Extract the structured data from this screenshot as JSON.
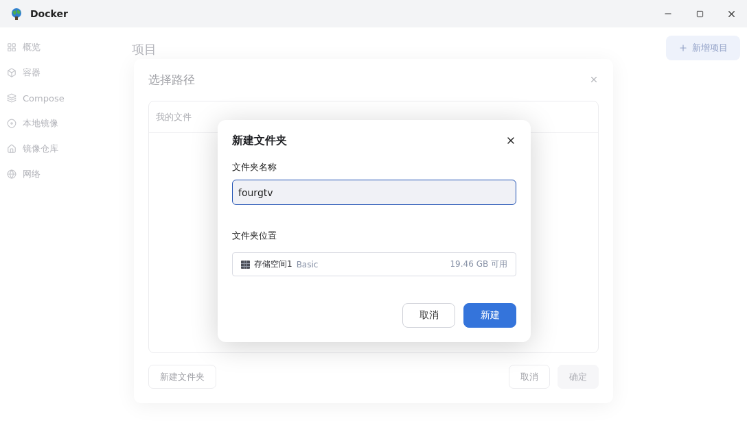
{
  "window": {
    "title": "Docker"
  },
  "sidebar": {
    "items": [
      {
        "kind": "grid",
        "label": "概览"
      },
      {
        "kind": "box",
        "label": "容器"
      },
      {
        "kind": "layers",
        "label": "Compose"
      },
      {
        "kind": "disc",
        "label": "本地镜像"
      },
      {
        "kind": "house",
        "label": "镜像仓库"
      },
      {
        "kind": "globe",
        "label": "网络"
      }
    ]
  },
  "page": {
    "title": "项目",
    "add_button": "新增项目"
  },
  "path_dialog": {
    "title": "选择路径",
    "root": "我的文件",
    "buttons": [
      {
        "label": "新建文件夹",
        "disabled": false
      },
      {
        "label": "取消",
        "disabled": false
      },
      {
        "label": "确定",
        "disabled": true
      }
    ]
  },
  "folder_dialog": {
    "title": "新建文件夹",
    "name_label": "文件夹名称",
    "name_value": "fourgtv",
    "location_label": "文件夹位置",
    "location": {
      "name": "存储空间1",
      "type": "Basic",
      "free": "19.46 GB 可用"
    },
    "buttons": [
      {
        "label": "取消",
        "primary": false
      },
      {
        "label": "新建",
        "primary": true
      }
    ]
  }
}
